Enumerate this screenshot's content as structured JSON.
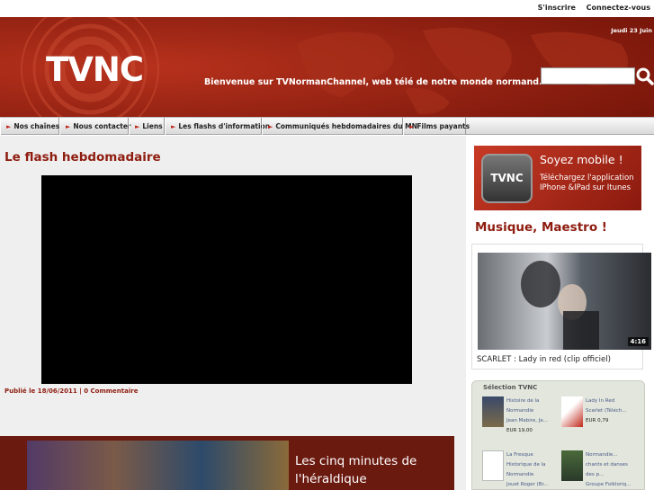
{
  "topbar": {
    "signup": "S'inscrire",
    "login": "Connectez-vous"
  },
  "header": {
    "logo": "TVNC",
    "welcome": "Bienvenue sur TVNormanChannel, web télé de notre monde normand.",
    "date": "Jeudi 23 Juin",
    "search": {
      "placeholder": ""
    }
  },
  "nav": {
    "items": [
      {
        "label": "Nos chaînes"
      },
      {
        "label": "Nous contacter"
      },
      {
        "label": "Liens"
      },
      {
        "label": "Les flashs d'information"
      },
      {
        "label": "Communiqués hebdomadaires du MN"
      },
      {
        "label": "Films payants"
      }
    ]
  },
  "main": {
    "title": "Le flash hebdomadaire",
    "meta": "Publié le 18/06/2011 | 0 Commentaire",
    "banner": {
      "line1": "Les cinq minutes de",
      "line2": "l'héraldique"
    }
  },
  "sidebar": {
    "app": {
      "icon_text": "TVNC",
      "title": "Soyez mobile !",
      "subtitle": "Téléchargez l'application IPhone &IPad sur Itunes"
    },
    "music": {
      "title": "Musique, Maestro !",
      "duration": "4:16",
      "caption": "SCARLET : Lady in red (clip officiel)"
    },
    "selection": {
      "title": "Sélection TVNC",
      "products": [
        {
          "line1": "Histoire de la",
          "line2": "Normandie",
          "line3": "Jean Mabire, Je...",
          "price": "EUR 19,00"
        },
        {
          "line1": "Lady In Red",
          "line2": "Scarlet (Téléch...",
          "line3": "",
          "price": "EUR 0,79"
        },
        {
          "line1": "La Fresque",
          "line2": "Historique de la",
          "line3": "Normandie",
          "price": "Jouet Roger (Br..."
        },
        {
          "line1": "Normandie...",
          "line2": "chants et danses",
          "line3": "des p...",
          "price": "Groupe Folkloriq..."
        }
      ]
    }
  },
  "colors": {
    "brand": "#8e1c0f",
    "nav_arrow": "#c0261a",
    "link": "#4a5a88"
  },
  "icons": [
    "search-icon",
    "nav-arrow-icon",
    "app-icon",
    "play-icon"
  ]
}
